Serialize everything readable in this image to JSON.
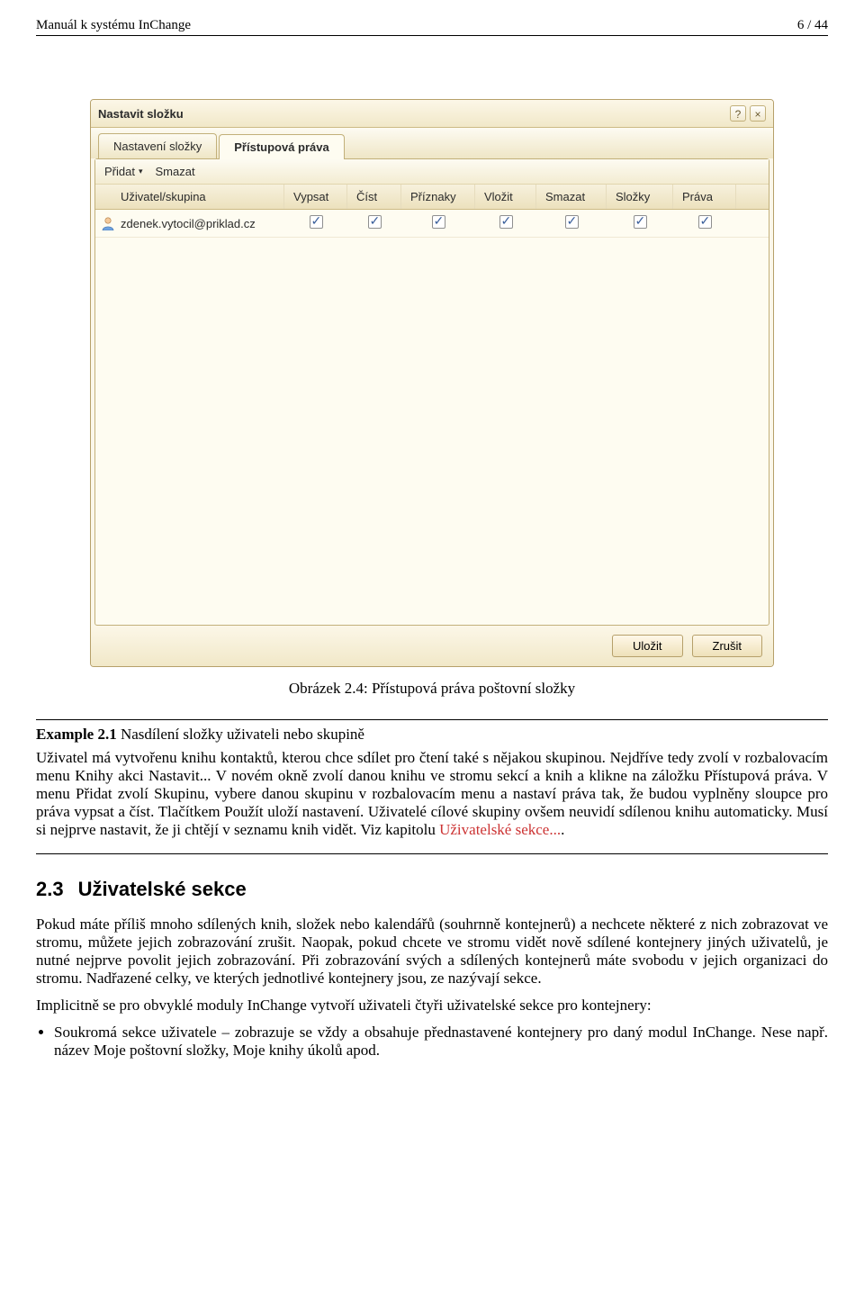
{
  "doc": {
    "header_left": "Manuál k systému InChange",
    "header_right": "6 / 44",
    "figure_caption": "Obrázek 2.4: Přístupová práva poštovní složky"
  },
  "sshot": {
    "title": "Nastavit složku",
    "help_icon": "?",
    "close_icon": "×",
    "tabs": [
      "Nastavení složky",
      "Přístupová práva"
    ],
    "toolbar": {
      "add": "Přidat",
      "add_caret": "▾",
      "delete": "Smazat"
    },
    "columns": [
      "Uživatel/skupina",
      "Vypsat",
      "Číst",
      "Příznaky",
      "Vložit",
      "Smazat",
      "Složky",
      "Práva"
    ],
    "row_user": "zdenek.vytocil@priklad.cz",
    "buttons": {
      "save": "Uložit",
      "cancel": "Zrušit"
    }
  },
  "example": {
    "title_prefix": "Example 2.1",
    "title_rest": " Nasdílení složky uživateli nebo skupině",
    "body": "Uživatel má vytvořenu knihu kontaktů, kterou chce sdílet pro čtení také s nějakou skupinou. Nejdříve tedy zvolí v rozbalovacím menu Knihy akci Nastavit... V novém okně zvolí danou knihu ve stromu sekcí a knih a klikne na záložku Přístupová práva. V menu Přidat zvolí Skupinu, vybere danou skupinu v rozbalovacím menu a nastaví práva tak, že budou vyplněny sloupce pro práva vypsat a číst. Tlačítkem Použít uloží nastavení. Uživatelé cílové skupiny ovšem neuvidí sdílenou knihu automaticky. Musí si nejprve nastavit, že ji chtějí v seznamu knih vidět. Viz kapitolu ",
    "link_text": "Uživatelské sekce...",
    "body_tail": "."
  },
  "section": {
    "num": "2.3",
    "title": "Uživatelské sekce",
    "p1": "Pokud máte příliš mnoho sdílených knih, složek nebo kalendářů (souhrnně kontejnerů) a nechcete některé z nich zobrazovat ve stromu, můžete jejich zobrazování zrušit. Naopak, pokud chcete ve stromu vidět nově sdílené kontejnery jiných uživatelů, je nutné nejprve povolit jejich zobrazování. Při zobrazování svých a sdílených kontejnerů máte svobodu v jejich organizaci do stromu. Nadřazené celky, ve kterých jednotlivé kontejnery jsou, ze nazývají sekce.",
    "p2": "Implicitně se pro obvyklé moduly InChange vytvoří uživateli čtyři uživatelské sekce pro kontejnery:",
    "li1": "Soukromá sekce uživatele – zobrazuje se vždy a obsahuje přednastavené kontejnery pro daný modul InChange. Nese např. název Moje poštovní složky, Moje knihy úkolů apod."
  }
}
